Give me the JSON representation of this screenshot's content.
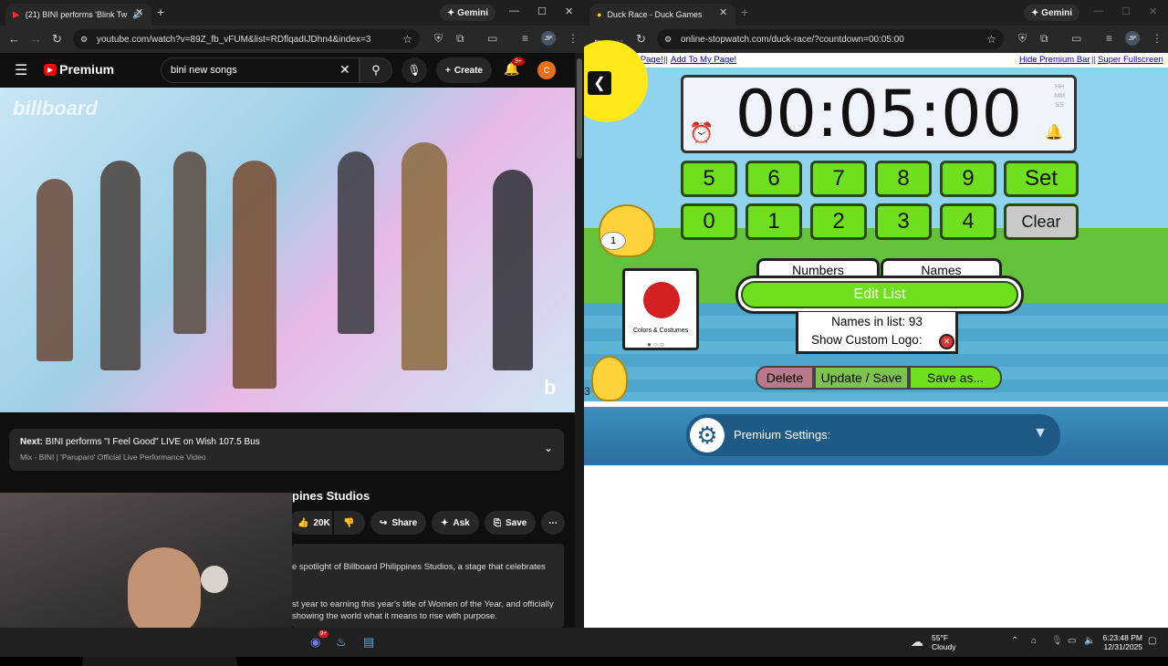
{
  "left_browser": {
    "tab_title": "(21) BINI performs 'Blink Tw",
    "gemini": "Gemini",
    "url": "youtube.com/watch?v=89Z_fb_vFUM&list=RDflqadIJDhn4&index=3",
    "profile": "JP"
  },
  "youtube": {
    "logo": "Premium",
    "search_value": "bini new songs",
    "create": "Create",
    "notif_count": "9+",
    "avatar": "C",
    "video_watermark": "billboard",
    "next_label": "Next:",
    "next_title": "BINI performs \"I Feel Good\" LIVE on Wish 107.5 Bus",
    "mix": "Mix - BINI | 'Paruparo' Official Live Performance Video",
    "video_title_fragment": "pines Studios",
    "likes": "20K",
    "share": "Share",
    "ask": "Ask",
    "save": "Save",
    "desc_line1": "e spotlight of Billboard Philippines Studios, a stage that celebrates",
    "desc_line2": "st year to earning this year's title of Women of the Year, and officially",
    "desc_line3": "showing the world what it means to rise with purpose."
  },
  "right_browser": {
    "tab_title": "Duck Race - Duck Games",
    "gemini": "Gemini",
    "url": "online-stopwatch.com/duck-race/?countdown=00:05:00",
    "profile": "JP"
  },
  "game": {
    "back_link": "< Back to My Page!",
    "add_link": "Add To My Page!",
    "hide_link": "Hide Premium Bar",
    "fullscreen_link": "Super Fullscreen",
    "time": "00:05:00",
    "units": [
      "HH",
      "MM",
      "SS"
    ],
    "keys_row1": [
      "5",
      "6",
      "7",
      "8",
      "9",
      "Set"
    ],
    "keys_row2": [
      "0",
      "1",
      "2",
      "3",
      "4",
      "Clear"
    ],
    "tab_numbers": "Numbers",
    "tab_names": "Names",
    "edit_list": "Edit List",
    "names_count": "Names in list: 93",
    "custom_logo": "Show Custom Logo:",
    "card_label": "Colors & Costumes",
    "delete": "Delete",
    "update": "Update / Save",
    "save_as": "Save as...",
    "duck1": "1",
    "duck3": "3",
    "premium_settings": "Premium Settings:"
  },
  "taskbar": {
    "temp": "55°F",
    "weather": "Cloudy",
    "time": "6:23:48 PM",
    "date": "12/31/2025",
    "discord_badge": "9+"
  },
  "colors": {
    "accent_green": "#6fe01d",
    "yt_red": "#ff0000",
    "premium_blue": "#2a6fa0"
  }
}
